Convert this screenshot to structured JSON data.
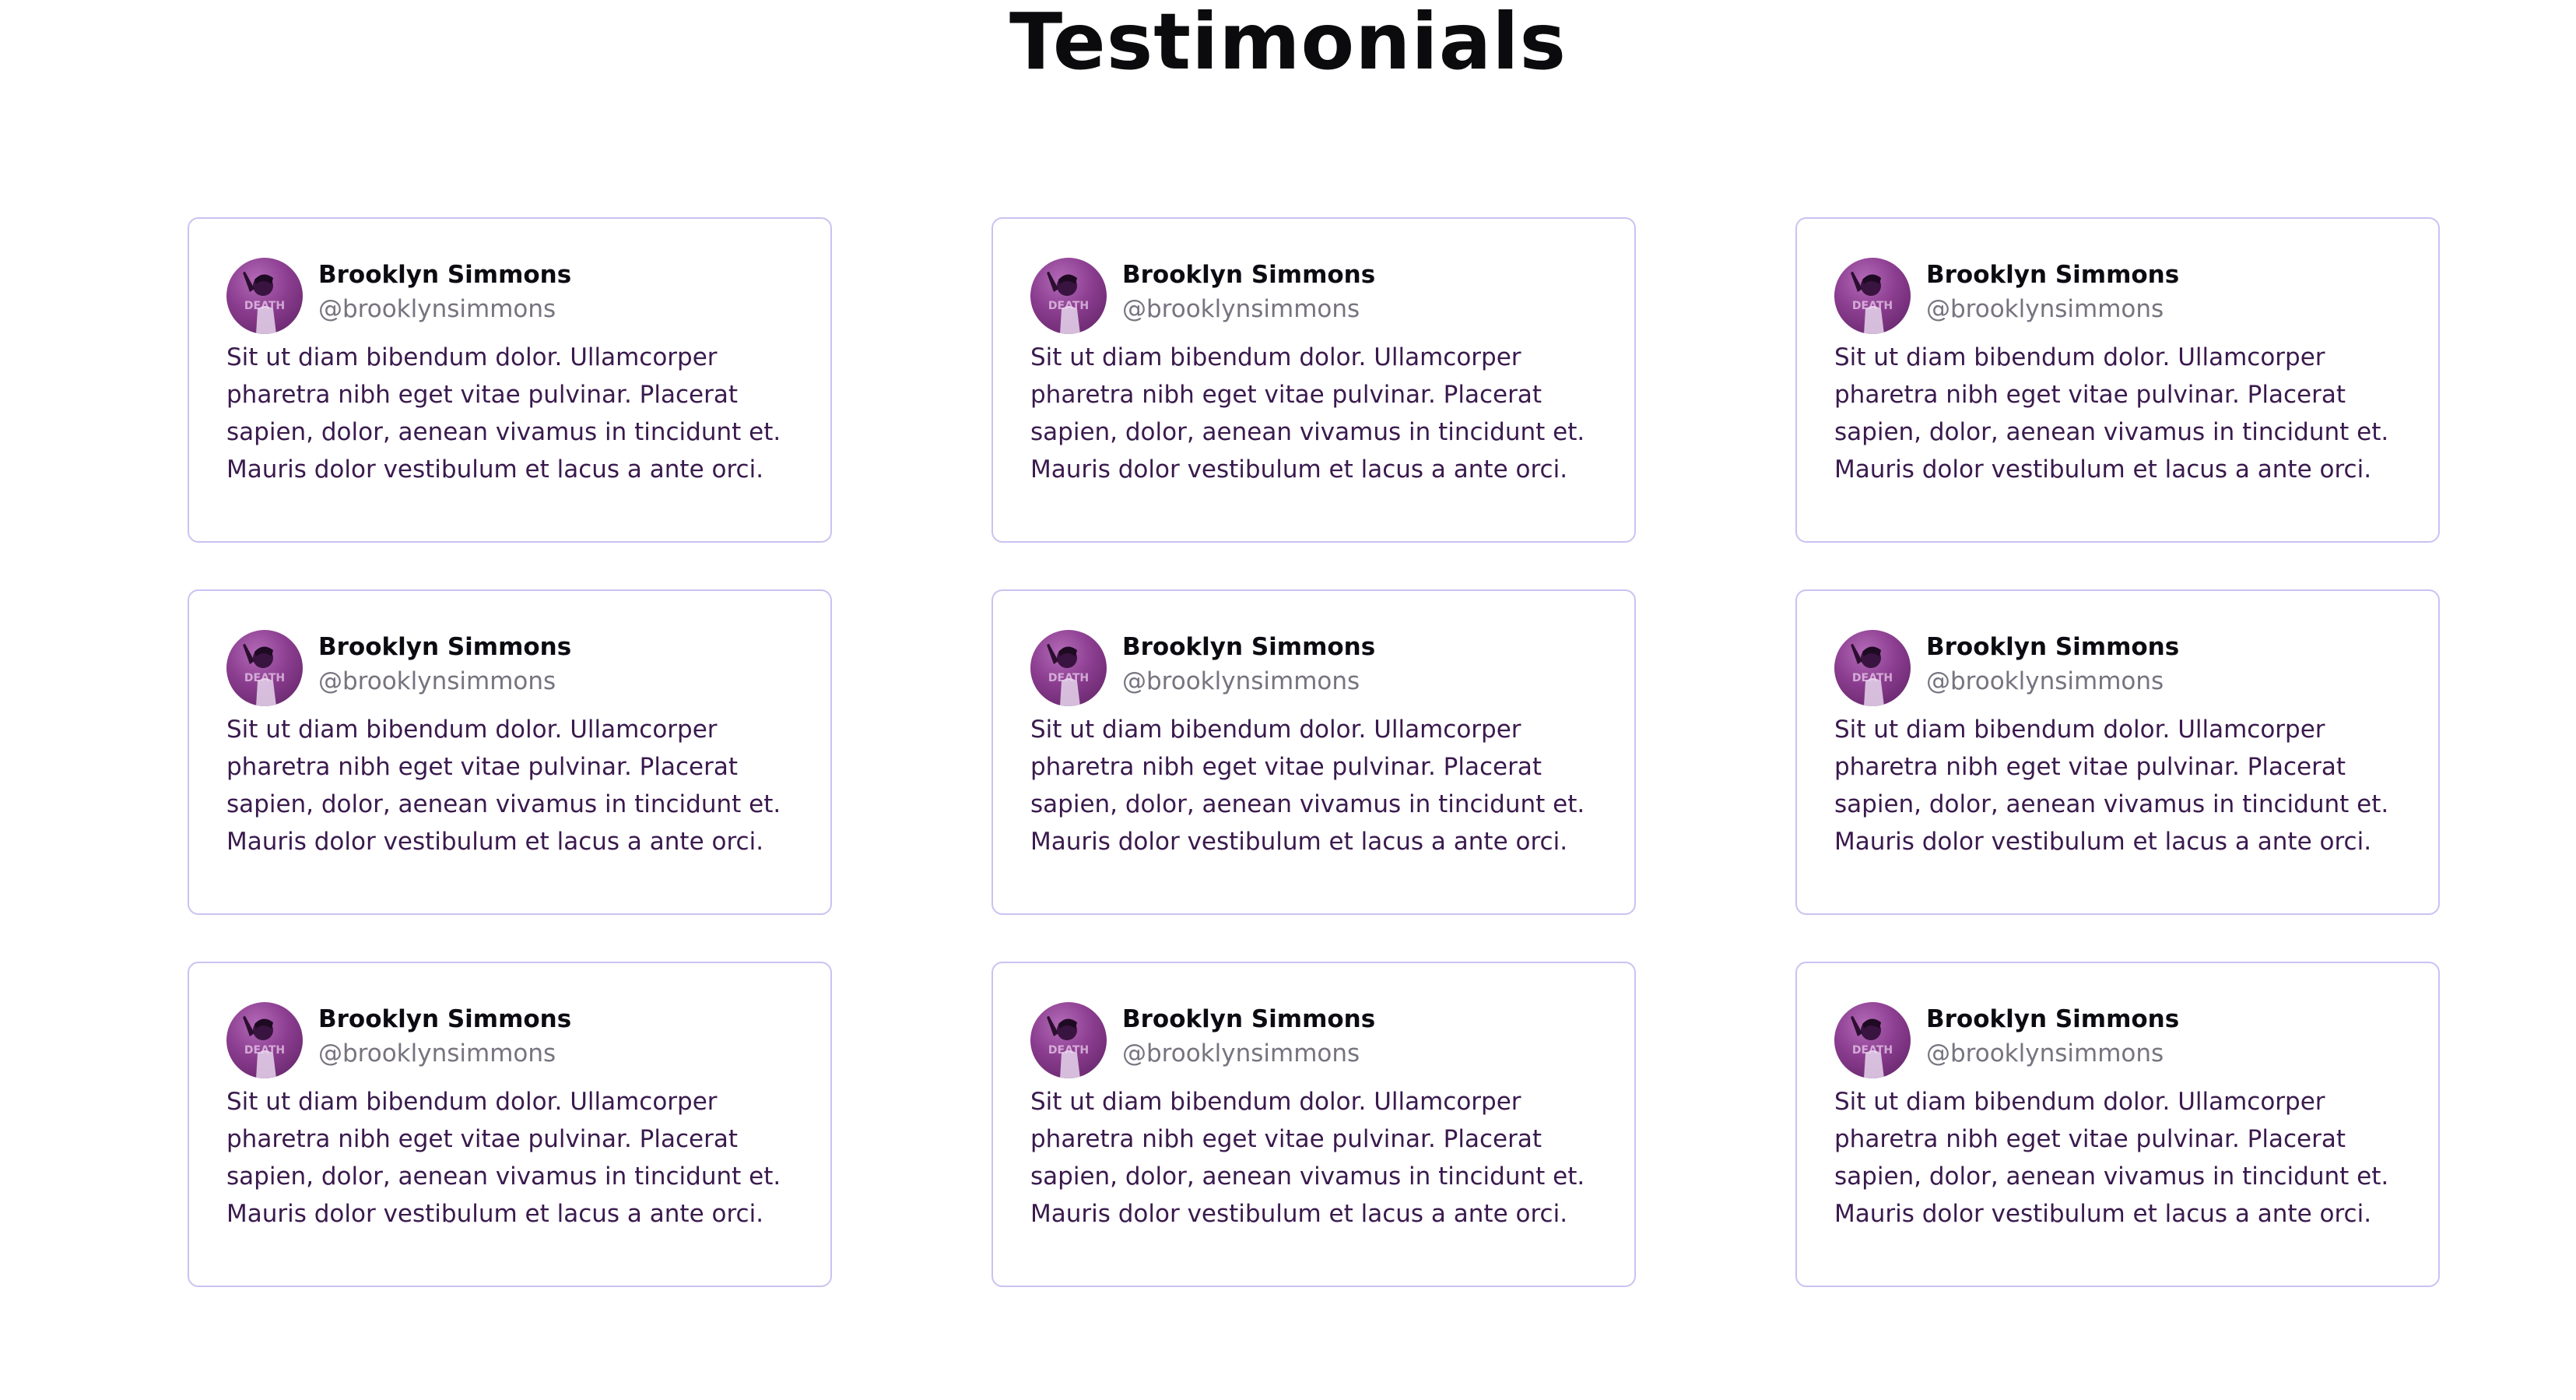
{
  "page": {
    "title": "Testimonials"
  },
  "colors": {
    "card_border": "#c9c3f2",
    "quote_text": "#3a1a4d",
    "handle_text": "#77737f",
    "avatar_tint": "#8b3d8f"
  },
  "testimonials": [
    {
      "name": "Brooklyn Simmons",
      "handle": "@brooklynsimmons",
      "quote": "Sit ut diam bibendum dolor. Ullamcorper pharetra nibh eget vitae pulvinar. Placerat sapien, dolor, aenean vivamus in tincidunt et. Mauris dolor vestibulum et lacus a ante orci.",
      "avatar_text": "DEATH",
      "avatar_icon": "profile-photo"
    },
    {
      "name": "Brooklyn Simmons",
      "handle": "@brooklynsimmons",
      "quote": "Sit ut diam bibendum dolor. Ullamcorper pharetra nibh eget vitae pulvinar. Placerat sapien, dolor, aenean vivamus in tincidunt et. Mauris dolor vestibulum et lacus a ante orci.",
      "avatar_text": "DEATH",
      "avatar_icon": "profile-photo"
    },
    {
      "name": "Brooklyn Simmons",
      "handle": "@brooklynsimmons",
      "quote": "Sit ut diam bibendum dolor. Ullamcorper pharetra nibh eget vitae pulvinar. Placerat sapien, dolor, aenean vivamus in tincidunt et. Mauris dolor vestibulum et lacus a ante orci.",
      "avatar_text": "DEATH",
      "avatar_icon": "profile-photo"
    },
    {
      "name": "Brooklyn Simmons",
      "handle": "@brooklynsimmons",
      "quote": "Sit ut diam bibendum dolor. Ullamcorper pharetra nibh eget vitae pulvinar. Placerat sapien, dolor, aenean vivamus in tincidunt et. Mauris dolor vestibulum et lacus a ante orci.",
      "avatar_text": "DEATH",
      "avatar_icon": "profile-photo"
    },
    {
      "name": "Brooklyn Simmons",
      "handle": "@brooklynsimmons",
      "quote": "Sit ut diam bibendum dolor. Ullamcorper pharetra nibh eget vitae pulvinar. Placerat sapien, dolor, aenean vivamus in tincidunt et. Mauris dolor vestibulum et lacus a ante orci.",
      "avatar_text": "DEATH",
      "avatar_icon": "profile-photo"
    },
    {
      "name": "Brooklyn Simmons",
      "handle": "@brooklynsimmons",
      "quote": "Sit ut diam bibendum dolor. Ullamcorper pharetra nibh eget vitae pulvinar. Placerat sapien, dolor, aenean vivamus in tincidunt et. Mauris dolor vestibulum et lacus a ante orci.",
      "avatar_text": "DEATH",
      "avatar_icon": "profile-photo"
    },
    {
      "name": "Brooklyn Simmons",
      "handle": "@brooklynsimmons",
      "quote": "Sit ut diam bibendum dolor. Ullamcorper pharetra nibh eget vitae pulvinar. Placerat sapien, dolor, aenean vivamus in tincidunt et. Mauris dolor vestibulum et lacus a ante orci.",
      "avatar_text": "DEATH",
      "avatar_icon": "profile-photo"
    },
    {
      "name": "Brooklyn Simmons",
      "handle": "@brooklynsimmons",
      "quote": "Sit ut diam bibendum dolor. Ullamcorper pharetra nibh eget vitae pulvinar. Placerat sapien, dolor, aenean vivamus in tincidunt et. Mauris dolor vestibulum et lacus a ante orci.",
      "avatar_text": "DEATH",
      "avatar_icon": "profile-photo"
    },
    {
      "name": "Brooklyn Simmons",
      "handle": "@brooklynsimmons",
      "quote": "Sit ut diam bibendum dolor. Ullamcorper pharetra nibh eget vitae pulvinar. Placerat sapien, dolor, aenean vivamus in tincidunt et. Mauris dolor vestibulum et lacus a ante orci.",
      "avatar_text": "DEATH",
      "avatar_icon": "profile-photo"
    }
  ]
}
